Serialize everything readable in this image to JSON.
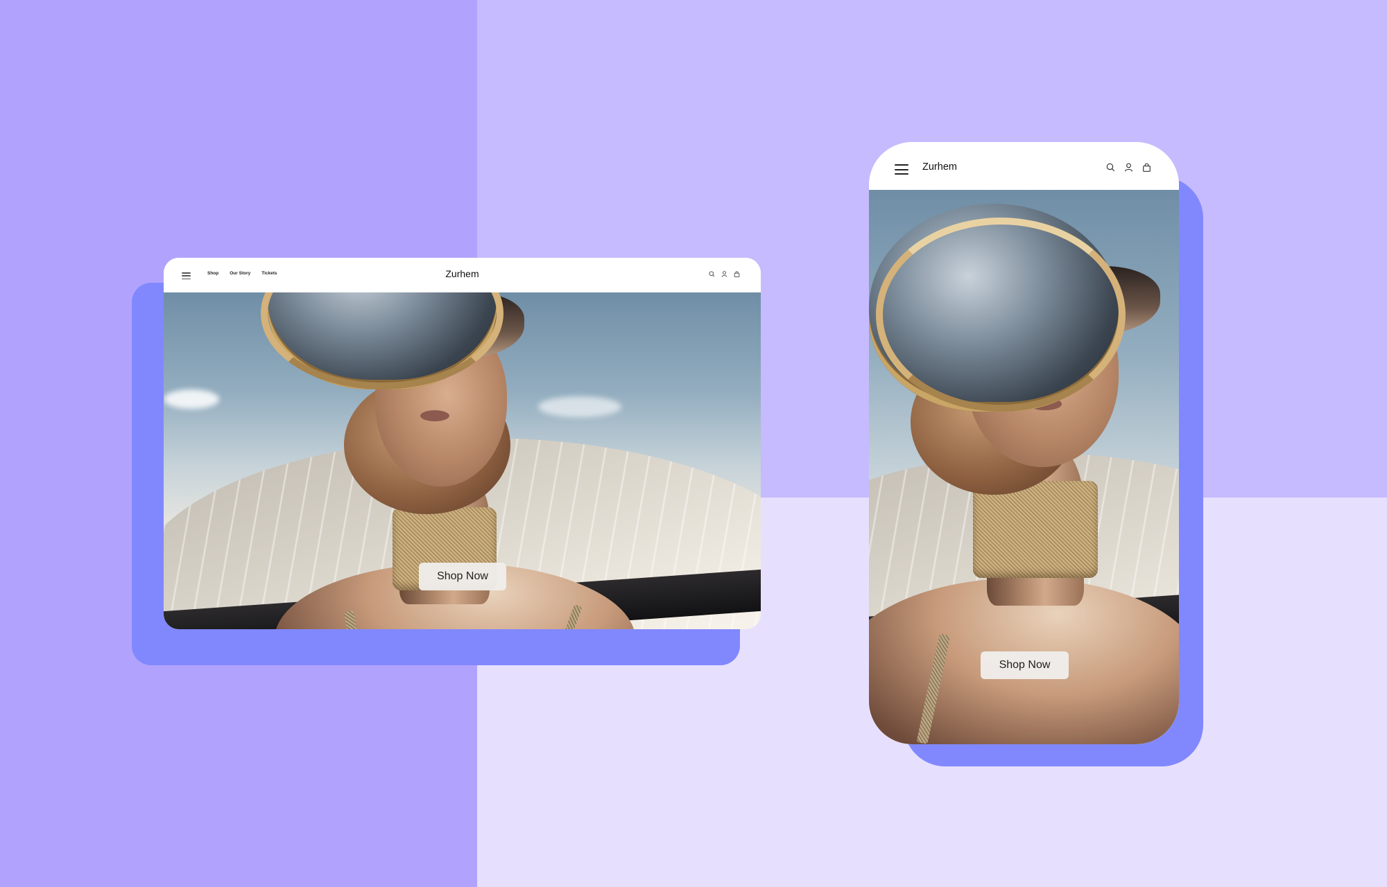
{
  "background": {
    "colors": {
      "left_panel": "#B1A3FD",
      "top_right_panel": "#C6BBFE",
      "bottom_right_panel": "#E6E0FE",
      "card_shadow": "#8188FE"
    }
  },
  "desktop_preview": {
    "header": {
      "menu_icon": "hamburger-icon",
      "nav_links": [
        "Shop",
        "Our Story",
        "Tickets"
      ],
      "brand": "Zurhem",
      "icons": [
        "search-icon",
        "user-icon",
        "shopping-bag-icon"
      ]
    },
    "hero": {
      "image": "model-with-gold-chrome-visor-helmet",
      "cta_label": "Shop Now"
    }
  },
  "mobile_preview": {
    "header": {
      "menu_icon": "hamburger-icon",
      "brand": "Zurhem",
      "icons": [
        "search-icon",
        "user-icon",
        "shopping-bag-icon"
      ]
    },
    "hero": {
      "image": "model-with-gold-chrome-visor-helmet",
      "cta_label": "Shop Now"
    }
  }
}
